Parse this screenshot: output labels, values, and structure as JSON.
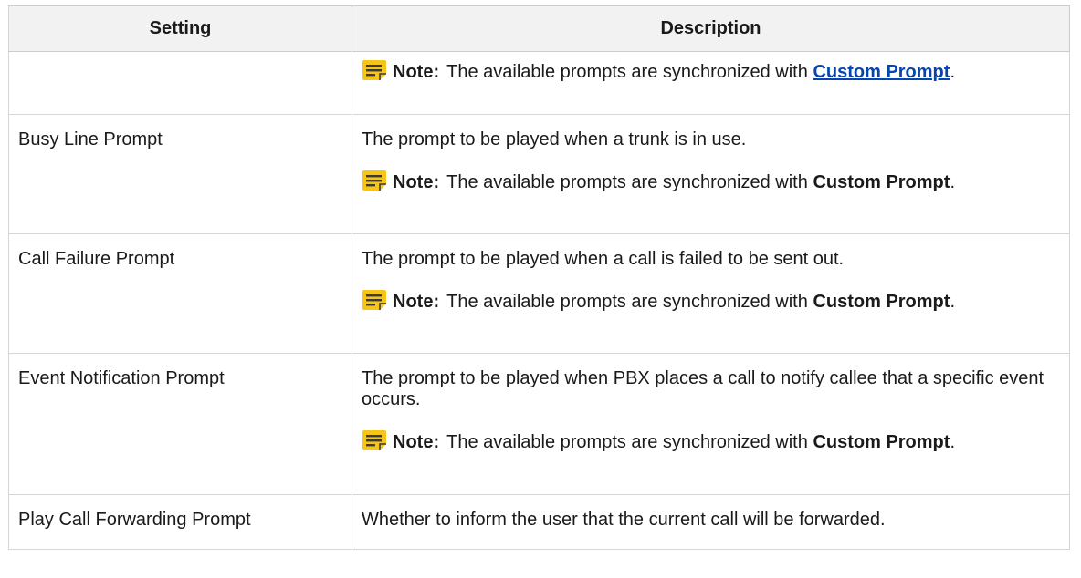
{
  "table": {
    "headers": {
      "setting": "Setting",
      "description": "Description"
    },
    "note_label": "Note:",
    "note_text": "The available prompts are synchronized with",
    "note_link": "Custom Prompt",
    "note_end": ".",
    "rows": [
      {
        "setting": "",
        "description": "",
        "note_is_link": true
      },
      {
        "setting": "Busy Line Prompt",
        "description": "The prompt to be played when a trunk is in use."
      },
      {
        "setting": "Call Failure Prompt",
        "description": "The prompt to be played when a call is failed to be sent out."
      },
      {
        "setting": "Event Notification Prompt",
        "description": "The prompt to be played when PBX places a call to notify callee that a specific event occurs."
      },
      {
        "setting": "Play Call Forwarding Prompt",
        "description": "Whether to inform the user that the current call will be forwarded."
      }
    ]
  },
  "colors": {
    "header_bg": "#f2f2f2",
    "border": "#d6d6d6",
    "note_icon": "#f5c518",
    "link": "#0645ad"
  }
}
